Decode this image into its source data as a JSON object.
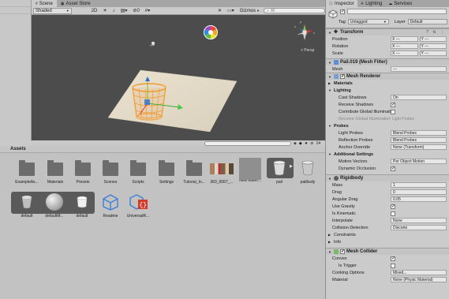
{
  "scene_tabs": [
    {
      "label": "Scene",
      "icon": "grid-icon"
    },
    {
      "label": "Asset Store",
      "icon": "store-icon"
    }
  ],
  "scene_toolbar": {
    "shading": "Shaded",
    "mode_2d": "2D",
    "hidden_count": "0",
    "gizmos": "Gizmos",
    "search_placeholder": "All"
  },
  "viewport": {
    "persp_label": "< Persp",
    "axis_labels": {
      "x": "x",
      "y": "y",
      "z": "z"
    }
  },
  "project": {
    "title": "Assets",
    "hidden_count": "14",
    "items": [
      {
        "label": "ExampleAs...",
        "kind": "folder"
      },
      {
        "label": "Materials",
        "kind": "folder"
      },
      {
        "label": "Presets",
        "kind": "folder"
      },
      {
        "label": "Scenes",
        "kind": "folder"
      },
      {
        "label": "Scripts",
        "kind": "folder"
      },
      {
        "label": "Settings",
        "kind": "folder"
      },
      {
        "label": "Tutorial_In...",
        "kind": "folder"
      },
      {
        "label": "360_0067_...",
        "kind": "image"
      },
      {
        "label": "New Mater...",
        "kind": "material"
      },
      {
        "label": "pail",
        "kind": "model"
      },
      {
        "label": "pailbody",
        "kind": "mesh"
      },
      {
        "label": "default",
        "kind": "mesh-sub"
      },
      {
        "label": "defaultM...",
        "kind": "material-sub"
      },
      {
        "label": "default",
        "kind": "mesh-sub2"
      },
      {
        "label": "Readme",
        "kind": "script"
      },
      {
        "label": "UniversalR...",
        "kind": "script"
      }
    ]
  },
  "inspector": {
    "tabs": [
      "Inspector",
      "Lighting",
      "Services"
    ],
    "tag_label": "Tag",
    "tag_value": "Untagged",
    "layer_label": "Layer",
    "layer_value": "Default",
    "transform": {
      "title": "Transform",
      "rows": [
        {
          "label": "Position",
          "x": "X ---",
          "y": "Y ---"
        },
        {
          "label": "Rotation",
          "x": "X ---",
          "y": "Y ---"
        },
        {
          "label": "Scale",
          "x": "X ---",
          "y": "Y ---"
        }
      ]
    },
    "mesh_filter": {
      "title": "Pail.019 (Mesh Filter)",
      "mesh_label": "Mesh",
      "mesh_value": "---"
    },
    "mesh_renderer": {
      "title": "Mesh Renderer",
      "materials_label": "Materials",
      "lighting_label": "Lighting",
      "cast_shadows_label": "Cast Shadows",
      "cast_shadows_value": "On",
      "receive_shadows_label": "Receive Shadows",
      "contribute_gi_label": "Contribute Global Illuminatio",
      "receive_gi_label": "Receive Global Illumination",
      "receive_gi_value": "Light Probes",
      "probes_label": "Probes",
      "light_probes_label": "Light Probes",
      "light_probes_value": "Blend Probes",
      "reflection_probes_label": "Reflection Probes",
      "reflection_probes_value": "Blend Probes",
      "anchor_override_label": "Anchor Override",
      "anchor_override_value": "None (Transform)",
      "additional_label": "Additional Settings",
      "motion_vectors_label": "Motion Vectors",
      "motion_vectors_value": "Per Object Motion",
      "dynamic_occlusion_label": "Dynamic Occlusion"
    },
    "rigidbody": {
      "title": "Rigidbody",
      "mass_label": "Mass",
      "mass_value": "1",
      "drag_label": "Drag",
      "drag_value": "0",
      "angular_drag_label": "Angular Drag",
      "angular_drag_value": "0.05",
      "use_gravity_label": "Use Gravity",
      "is_kinematic_label": "Is Kinematic",
      "interpolate_label": "Interpolate",
      "interpolate_value": "None",
      "collision_label": "Collision Detection",
      "collision_value": "Discrete",
      "constraints_label": "Constraints",
      "info_label": "Info"
    },
    "mesh_collider": {
      "title": "Mesh Collider",
      "convex_label": "Convex",
      "is_trigger_label": "Is Trigger",
      "cooking_label": "Cooking Options",
      "cooking_value": "Mixed...",
      "material_label": "Material",
      "material_value": "None (Physic Material)"
    }
  }
}
